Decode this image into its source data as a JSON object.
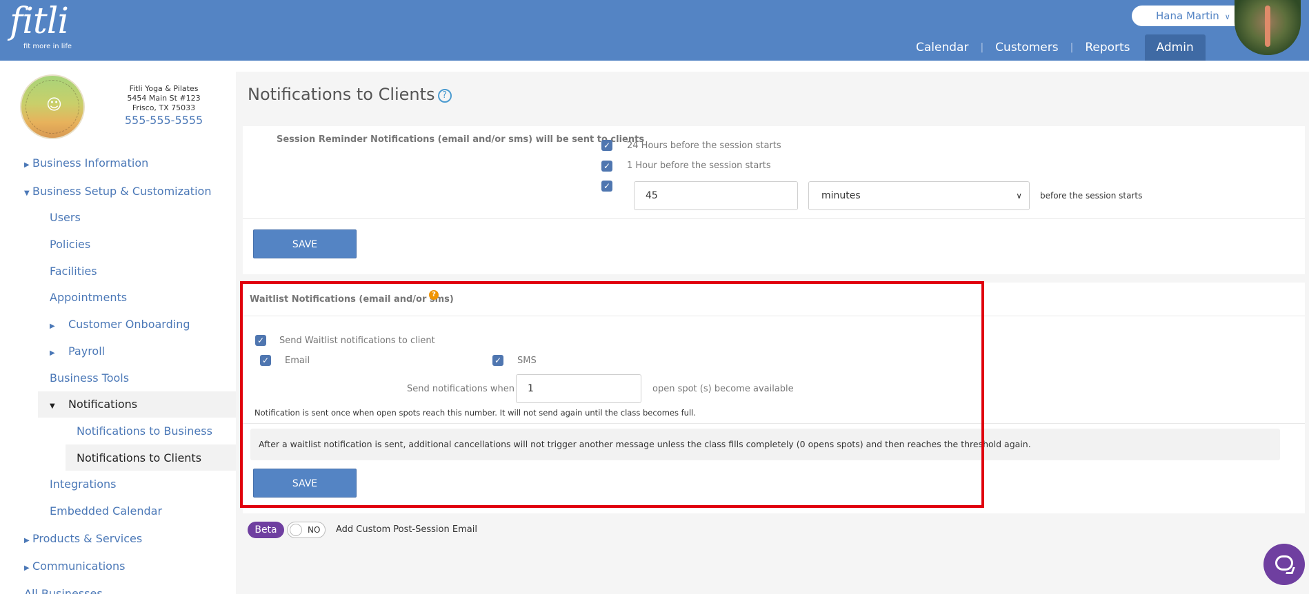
{
  "header": {
    "logo_text": "fitli",
    "logo_tagline": "fit more in life",
    "user_name": "Hana Martin",
    "nav": [
      "Calendar",
      "Customers",
      "Reports",
      "Admin"
    ],
    "active_nav": "Admin"
  },
  "business": {
    "name": "Fitli Yoga & Pilates",
    "address1": "5454 Main St #123",
    "address2": "Frisco, TX 75033",
    "phone": "555-555-5555"
  },
  "sidebar": {
    "business_information": "Business Information",
    "business_setup": "Business Setup & Customization",
    "users": "Users",
    "policies": "Policies",
    "facilities": "Facilities",
    "appointments": "Appointments",
    "customer_onboarding": "Customer Onboarding",
    "payroll": "Payroll",
    "business_tools": "Business Tools",
    "notifications": "Notifications",
    "notifications_business": "Notifications to Business",
    "notifications_clients": "Notifications to Clients",
    "integrations": "Integrations",
    "embedded_calendar": "Embedded Calendar",
    "products_services": "Products & Services",
    "communications": "Communications",
    "all_businesses": "All Businesses"
  },
  "page": {
    "title": "Notifications to Clients"
  },
  "reminders": {
    "heading": "Session Reminder Notifications (email and/or sms) will be sent to clients",
    "opt_24h": "24 Hours before the session starts",
    "opt_1h": "1 Hour before the session starts",
    "custom_value": "45",
    "custom_unit": "minutes",
    "custom_suffix": "before the session starts",
    "opt_24h_checked": true,
    "opt_1h_checked": true,
    "custom_checked": true,
    "save_label": "SAVE"
  },
  "waitlist": {
    "heading": "Waitlist Notifications (email and/or sms)",
    "help": "?",
    "send_label": "Send Waitlist notifications to client",
    "send_checked": true,
    "email_label": "Email",
    "email_checked": true,
    "sms_label": "SMS",
    "sms_checked": true,
    "when_label": "Send notifications when",
    "when_value": "1",
    "when_suffix": "open spot (s) become available",
    "info_text": "Notification is sent once when open spots reach this number. It will not send again until the class becomes full.",
    "note_text": "After a waitlist notification is sent, additional cancellations will not trigger another message unless the class fills completely (0 opens spots) and then reaches the threshold again.",
    "save_label": "SAVE"
  },
  "post_session": {
    "badge": "Beta",
    "toggle_text": "NO",
    "label": "Add Custom Post-Session Email"
  },
  "colors": {
    "header_bg": "#5484c4",
    "accent": "#5484c4",
    "highlight_frame": "#e0000d",
    "beta_badge": "#6f3fa0"
  }
}
